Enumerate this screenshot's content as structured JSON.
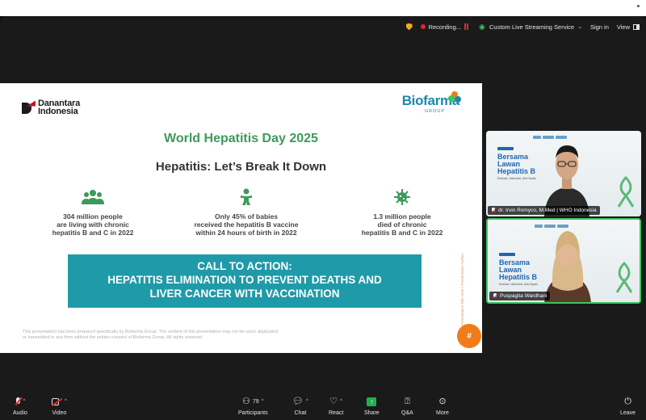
{
  "status_bar": {
    "recording_label": "Recording...",
    "streaming_label": "Custom Live Streaming Service",
    "signin_label": "Sign in",
    "view_label": "View"
  },
  "slide": {
    "brand_left_line1": "Danantara",
    "brand_left_line2": "Indonesia",
    "brand_right": "Biofarma",
    "brand_right_sub": "GROUP",
    "title": "World Hepatitis Day 2025",
    "subtitle": "Hepatitis: Let’s Break It Down",
    "stats": [
      {
        "icon": "people-group-icon",
        "line1": "304 million people",
        "line2": "are living with chronic",
        "line3": "hepatitis B and C in 2022"
      },
      {
        "icon": "baby-icon",
        "line1": "Only 45% of babies",
        "line2": "received the hepatitis B vaccine",
        "line3": "within 24 hours of birth in 2022"
      },
      {
        "icon": "virus-icon",
        "line1": "1.3 million people",
        "line2": "died of chronic",
        "line3": "hepatitis B and C in 2022"
      }
    ],
    "cta_line1": "CALL TO ACTION:",
    "cta_line2": "HEPATITIS ELIMINATION TO PREVENT DEATHS AND",
    "cta_line3": "LIVER CANCER WITH VACCINATION",
    "disclaimer": "This presentation has been prepared specifically by Biofarma Group. The content of this presentation may not be used, duplicated or transmitted in any form without the written consent of Biofarma Group. All rights reserved.",
    "side_text": "Presentation Title Here  |  Presentation Author",
    "badge": "#"
  },
  "participants": [
    {
      "name": "dr. Irvin Romyco, M.Med | WHO Indonesia",
      "poster_line1": "Bersama",
      "poster_line2": "Lawan",
      "poster_line3": "Hepatitis B",
      "poster_small": "Edukasi, Vaksinasi, Aksi Nyata"
    },
    {
      "name": "Puspagita Wardhani",
      "poster_line1": "Bersama",
      "poster_line2": "Lawan",
      "poster_line3": "Hepatitis B",
      "poster_small": "Edukasi, Vaksinasi, Aksi Nyata"
    }
  ],
  "toolbar": {
    "audio": "Audio",
    "video": "Video",
    "participants": "Participants",
    "participant_count": "79",
    "chat": "Chat",
    "react": "React",
    "share": "Share",
    "qa": "Q&A",
    "more": "More",
    "leave": "Leave"
  },
  "colors": {
    "accent_green": "#3d9a5a",
    "cta_teal": "#1f9aa8",
    "record_red": "#e02828",
    "share_green": "#22b04b",
    "active_speaker": "#3ec45d"
  }
}
